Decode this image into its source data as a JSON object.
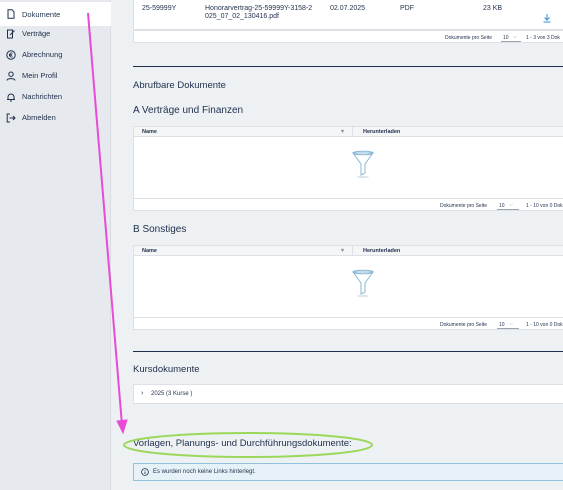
{
  "sidebar": {
    "items": [
      {
        "label": "Dokumente",
        "icon": "document-icon",
        "active": true
      },
      {
        "label": "Verträge",
        "icon": "contract-icon"
      },
      {
        "label": "Abrechnung",
        "icon": "euro-icon"
      },
      {
        "label": "Mein Profil",
        "icon": "user-icon"
      },
      {
        "label": "Nachrichten",
        "icon": "bell-icon"
      },
      {
        "label": "Abmelden",
        "icon": "logout-icon"
      }
    ]
  },
  "top_table": {
    "row": {
      "number": "25-59999Y",
      "filename": "Honorarvertrag-25-59999Y-3158-2025_07_02_130416.pdf",
      "filename_line1": "Honorarvertrag-25-59999Y-3158-2",
      "filename_line2": "025_07_02_130416.pdf",
      "date": "02.07.2025",
      "type": "PDF",
      "size": "23 KB"
    },
    "pager": {
      "per_page_label": "Dokumente pro Seite",
      "per_page": "10",
      "range": "1 - 3 von 3 Dok"
    }
  },
  "abrufbare": {
    "heading": "Abrufbare Dokumente"
  },
  "section_a": {
    "heading": "A Verträge und Finanzen",
    "columns": [
      "Name",
      "Herunterladen"
    ],
    "pager": {
      "per_page_label": "Dokumente pro Seite",
      "per_page": "10",
      "range": "1 - 10 von 0 Dok"
    }
  },
  "section_b": {
    "heading": "B Sonstiges",
    "columns": [
      "Name",
      "Herunterladen"
    ],
    "pager": {
      "per_page_label": "Dokumente pro Seite",
      "per_page": "10",
      "range": "1 - 10 von 0 Dok"
    }
  },
  "kurs": {
    "heading": "Kursdokumente",
    "accordion_label": "2025 (3 Kurse )"
  },
  "vorlagen": {
    "heading": "Vorlagen, Planungs- und Durchführungsdokumente:",
    "info_text": "Es wurden noch keine Links hinterlegt."
  },
  "annotation": {
    "arrow_color": "#e84bd6",
    "ellipse_color": "#9bd85a"
  }
}
